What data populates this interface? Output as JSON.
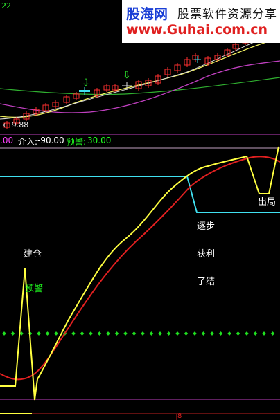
{
  "top_panel": {
    "corner_value": "22",
    "low_price_label": "← 9.88",
    "marker_symbols": [
      "⇩",
      "⇩",
      "+",
      "+"
    ]
  },
  "header_bar": {
    "partial_value": ".00",
    "entry_label": "介入:",
    "entry_value": "-90.00",
    "warn_label": "预警:",
    "warn_value": "30.00"
  },
  "annotations": {
    "build": "建仓",
    "warn": "预警",
    "step": "逐步",
    "profit": "获利",
    "close": "了结",
    "exit": "出局"
  },
  "banner": {
    "logo_cn": "股海网",
    "slogan": "股票软件资源分享",
    "url": "www.Guhai.com.cn"
  },
  "bottom_marker": "8",
  "colors": {
    "background": "#000000",
    "up_candle": "#ff3030",
    "ma_yellow": "#f0f060",
    "ma_magenta": "#c040c0",
    "ma_green": "#30c030",
    "signal_yellow": "#ffff40",
    "signal_red": "#e02020",
    "cyan": "#40e0f0",
    "dots_green": "#20e020",
    "entry_value": "#ffffff",
    "warn_text": "#20ff20"
  }
}
